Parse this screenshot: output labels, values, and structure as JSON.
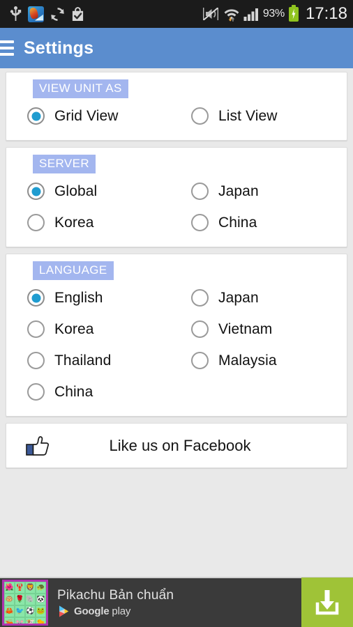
{
  "status_bar": {
    "icons_left": [
      "usb-icon",
      "game-app-icon",
      "sync-icon",
      "play-store-bag-icon"
    ],
    "icons_right": [
      "vibrate-mute-icon",
      "wifi-icon",
      "cellular-signal-icon"
    ],
    "battery_percent": "93%",
    "battery_state": "charging",
    "clock": "17:18"
  },
  "app_bar": {
    "menu_icon": "hamburger-menu-icon",
    "title": "Settings",
    "color": "#5b8dce"
  },
  "theme": {
    "accent": "#1f9cd0",
    "label_bg": "#a3b6ef",
    "page_bg": "#e9e9e9",
    "card_bg": "#ffffff"
  },
  "sections": [
    {
      "key": "view_unit_as",
      "label": "VIEW UNIT AS",
      "options": [
        {
          "label": "Grid View",
          "selected": true
        },
        {
          "label": "List View",
          "selected": false
        }
      ]
    },
    {
      "key": "server",
      "label": "SERVER",
      "options": [
        {
          "label": "Global",
          "selected": true
        },
        {
          "label": "Japan",
          "selected": false
        },
        {
          "label": "Korea",
          "selected": false
        },
        {
          "label": "China",
          "selected": false
        }
      ]
    },
    {
      "key": "language",
      "label": "LANGUAGE",
      "options": [
        {
          "label": "English",
          "selected": true
        },
        {
          "label": "Japan",
          "selected": false
        },
        {
          "label": "Korea",
          "selected": false
        },
        {
          "label": "Vietnam",
          "selected": false
        },
        {
          "label": "Thailand",
          "selected": false
        },
        {
          "label": "Malaysia",
          "selected": false
        },
        {
          "label": "China",
          "selected": false
        }
      ]
    }
  ],
  "facebook": {
    "icon": "thumbs-up-icon",
    "label": "Like us on Facebook"
  },
  "ad": {
    "thumbnail_icon": "game-tiles-thumbnail",
    "title": "Pikachu Bản chuẩn",
    "store": "Google",
    "store_suffix": " play",
    "cta_icon": "download-icon",
    "cta_color": "#9fc337"
  }
}
